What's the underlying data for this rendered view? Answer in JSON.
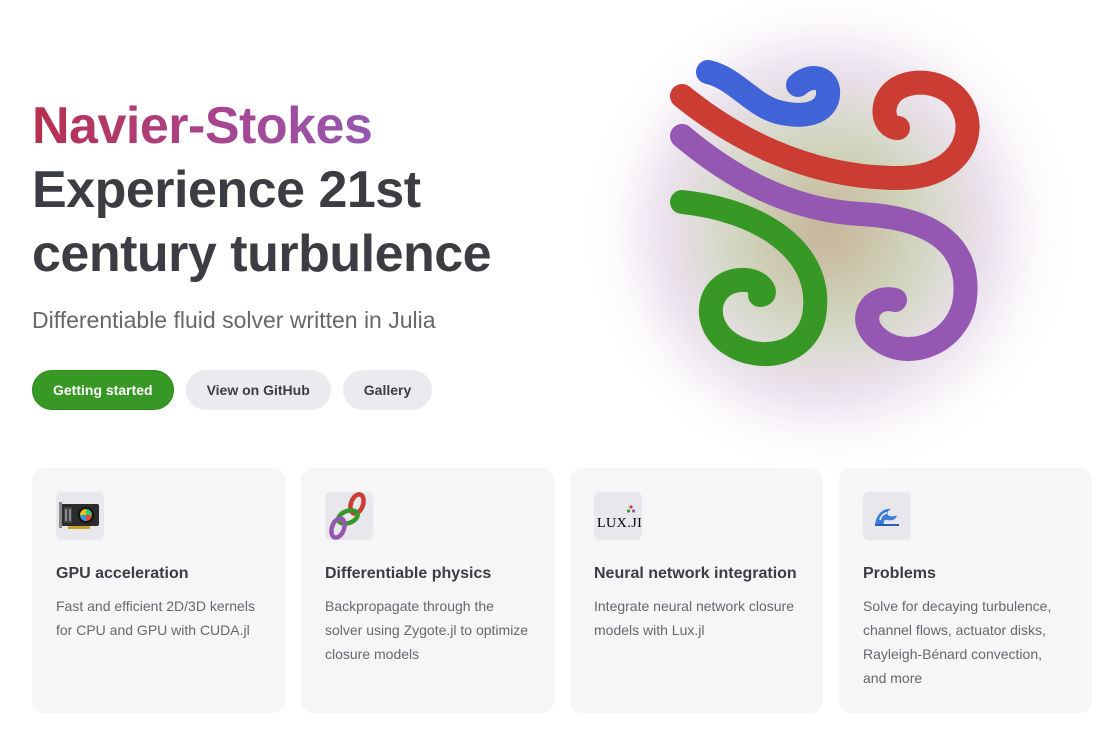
{
  "hero": {
    "name": "Navier-Stokes",
    "title_line1": "Experience 21st",
    "title_line2": "century turbulence",
    "tagline": "Differentiable fluid solver written in Julia",
    "actions": [
      {
        "label": "Getting started",
        "theme": "brand"
      },
      {
        "label": "View on GitHub",
        "theme": "alt"
      },
      {
        "label": "Gallery",
        "theme": "alt"
      }
    ],
    "logo": {
      "icon": "julia-swirl-logo",
      "colors": [
        "#4063d8",
        "#cb3c33",
        "#9558b2",
        "#389826"
      ]
    }
  },
  "colors": {
    "brand": "#389826",
    "name_gradient_start": "#b7304e",
    "name_gradient_end": "#9558b2"
  },
  "features": [
    {
      "icon": "gpu-card-icon",
      "title": "GPU acceleration",
      "details": "Fast and efficient 2D/3D kernels for CPU and GPU with CUDA.jl"
    },
    {
      "icon": "chain-links-icon",
      "title": "Differentiable physics",
      "details": "Backpropagate through the solver using Zygote.jl to optimize closure models"
    },
    {
      "icon": "lux-logo-icon",
      "icon_text": "LUX.JL",
      "title": "Neural network integration",
      "details": "Integrate neural network closure models with Lux.jl"
    },
    {
      "icon": "wave-icon",
      "title": "Problems",
      "details": "Solve for decaying turbulence, channel flows, actuator disks, Rayleigh-Bénard convection, and more"
    }
  ]
}
